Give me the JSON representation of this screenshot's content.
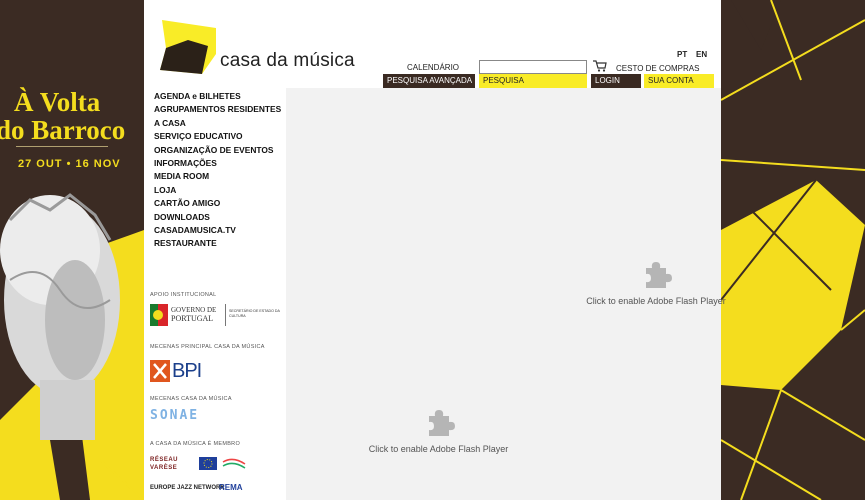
{
  "promo": {
    "line1": "À Volta",
    "line2": "do Barroco",
    "dates": "27 OUT • 16 NOV"
  },
  "brand": {
    "name": "casa da música"
  },
  "lang": {
    "pt": "PT",
    "en": "EN"
  },
  "topbar": {
    "calendar": "CALENDÁRIO",
    "search_value": "",
    "cart": "CESTO DE COMPRAS",
    "advanced_search": "PESQUISA AVANÇADA",
    "search": "PESQUISA",
    "login": "LOGIN",
    "account": "SUA CONTA"
  },
  "nav": {
    "items": [
      "AGENDA e BILHETES",
      "AGRUPAMENTOS RESIDENTES",
      "A CASA",
      "SERVIÇO EDUCATIVO",
      "ORGANIZAÇÃO DE EVENTOS",
      "INFORMAÇÕES",
      "MEDIA ROOM",
      "LOJA",
      "CARTÃO AMIGO",
      "DOWNLOADS",
      "CASADAMUSICA.TV",
      "RESTAURANTE"
    ]
  },
  "sponsors": {
    "institutional": "APOIO INSTITUCIONAL",
    "gov_line1": "GOVERNO DE",
    "gov_line2": "PORTUGAL",
    "gov_sub": "SECRETÁRIO DE ESTADO DA CULTURA",
    "main_patron": "MECENAS PRINCIPAL CASA DA MÚSICA",
    "bpi": "BPI",
    "patron": "MECENAS CASA DA MÚSICA",
    "sonae": "SONAE",
    "member": "A CASA DA MÚSICA É MEMBRO",
    "reseau": "RÉSEAU VARÈSE",
    "europe_jazz": "EUROPE JAZZ NETWORK",
    "rema": "REMA"
  },
  "flash": {
    "message": "Click to enable Adobe Flash Player"
  },
  "colors": {
    "brown": "#3a2a22",
    "yellow": "#f9ec27"
  }
}
